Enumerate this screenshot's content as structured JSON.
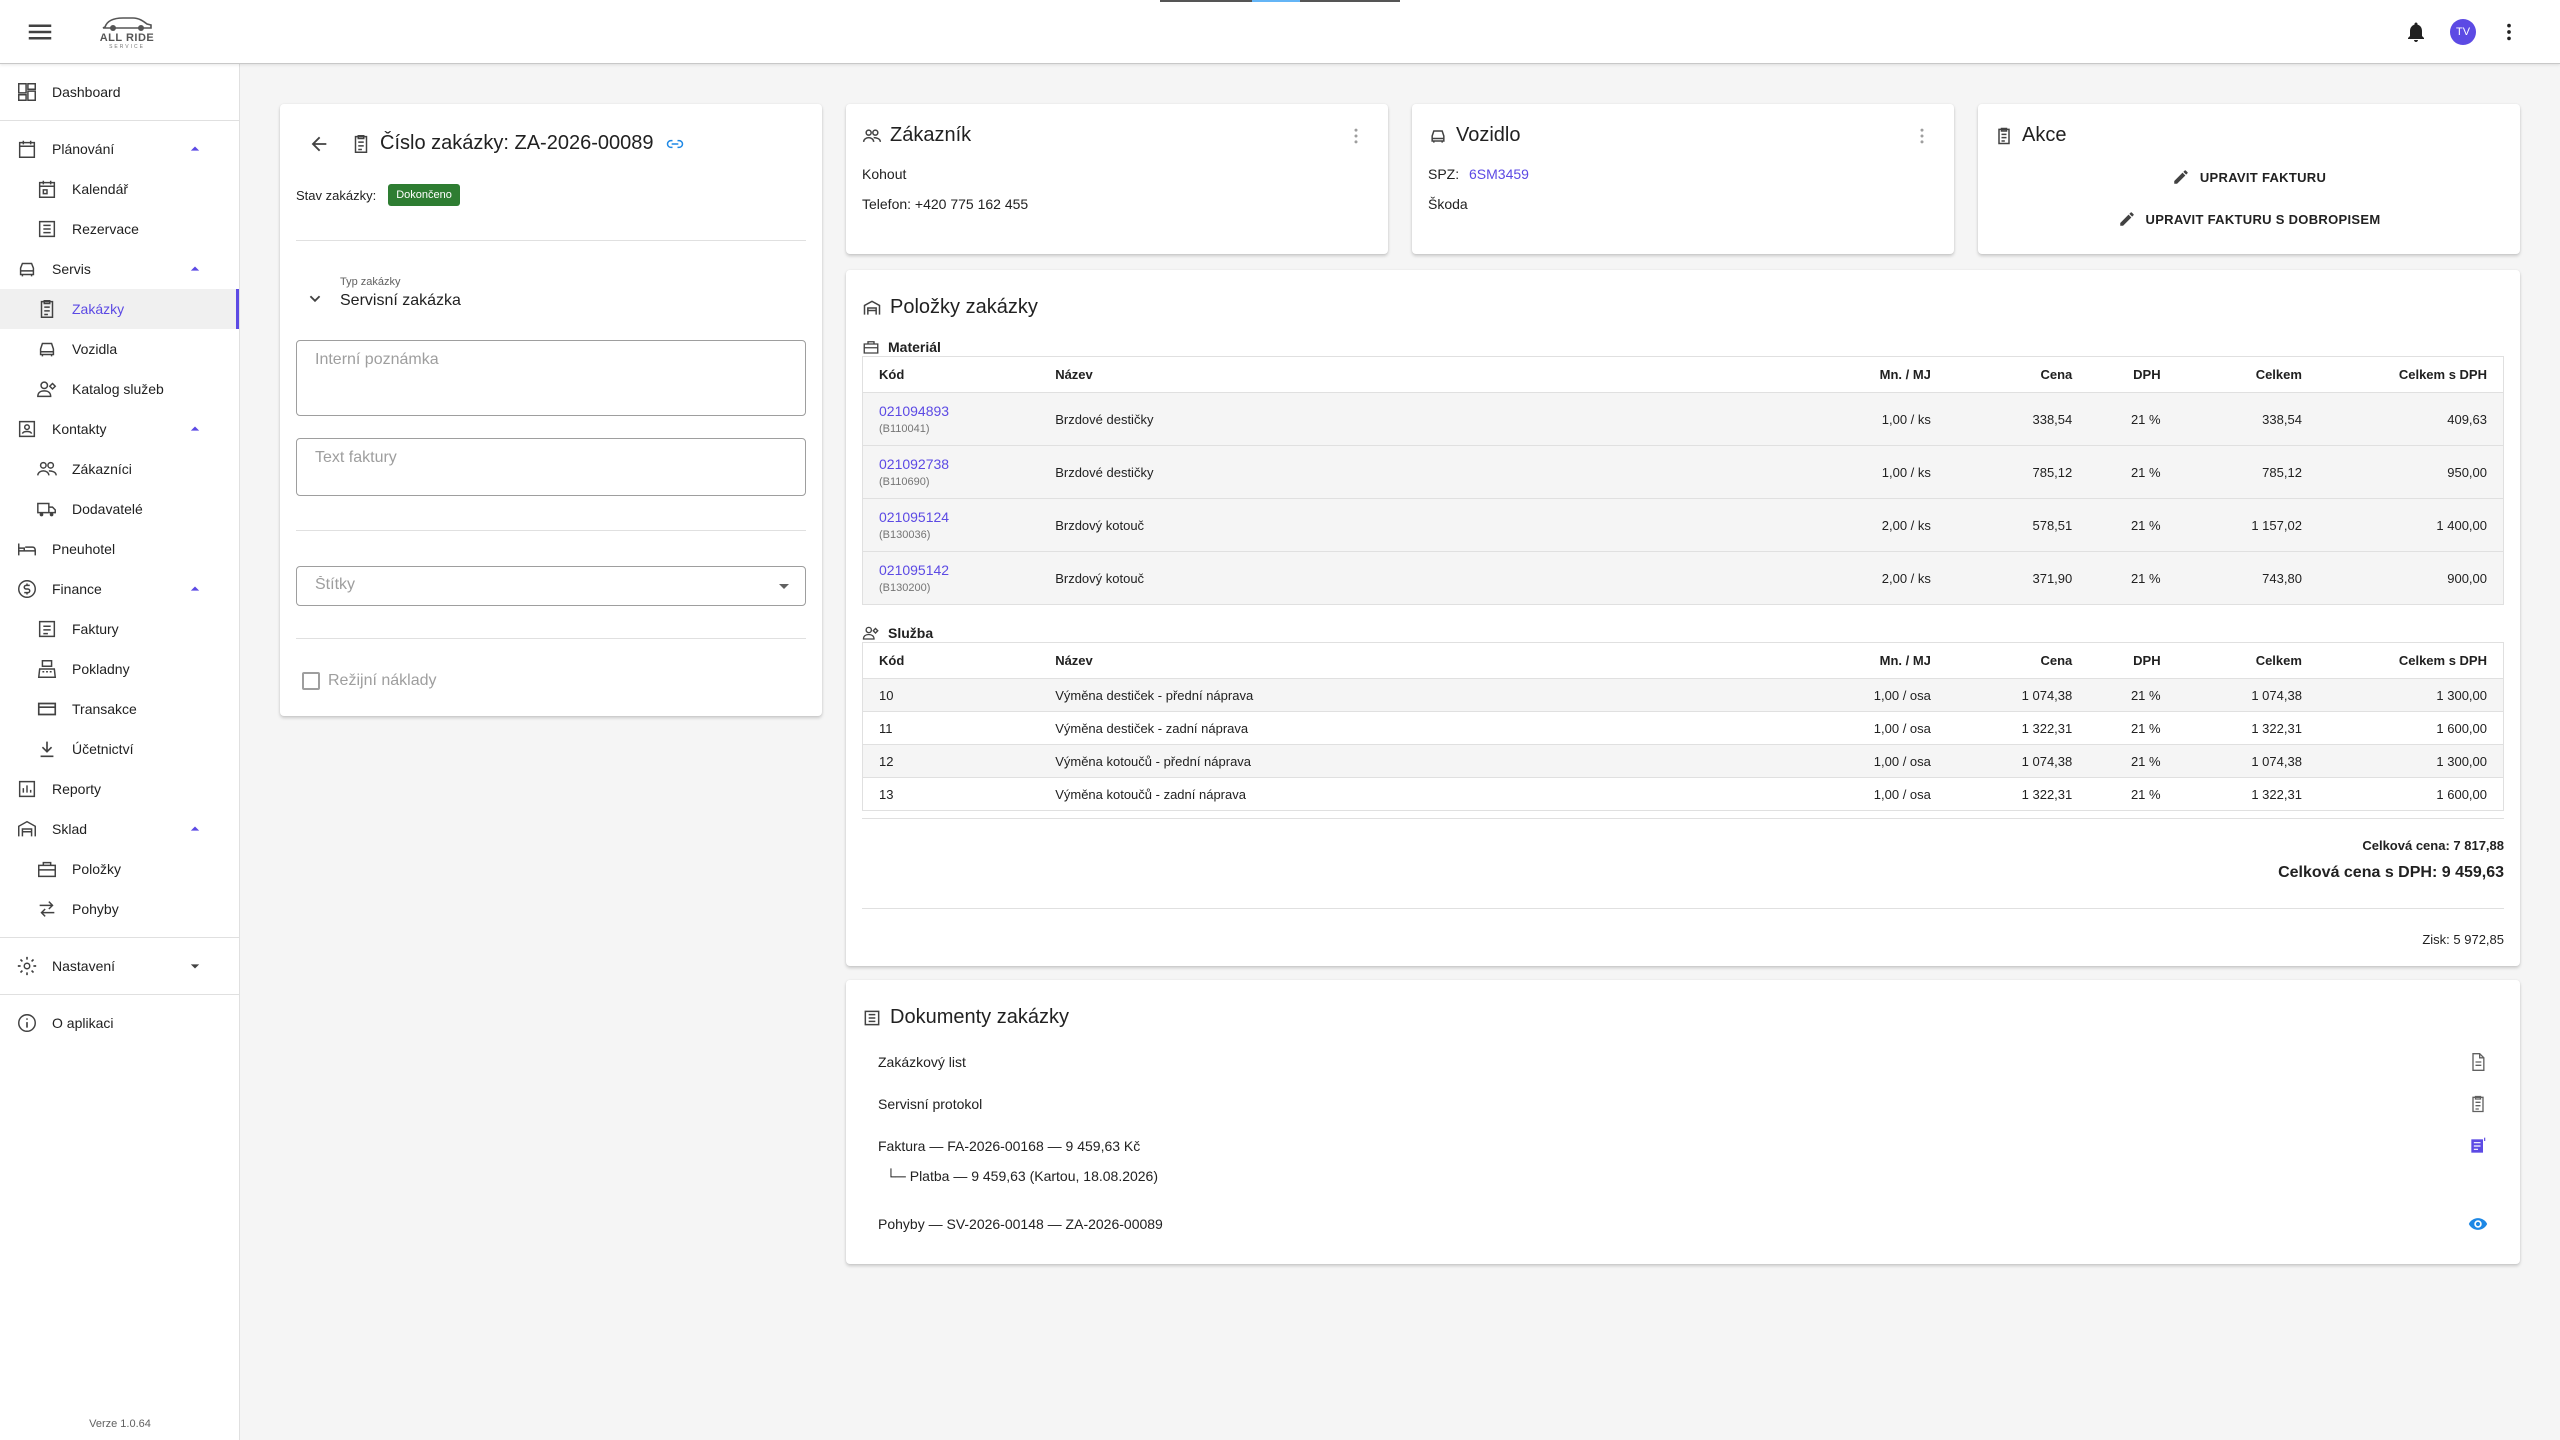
{
  "app": {
    "logo_text": "ALL RIDE",
    "logo_sub": "SERVICE",
    "avatar_initials": "TV",
    "version": "Verze 1.0.64"
  },
  "colors": {
    "accent": "#5c4ae4",
    "status_green": "#2e7d32",
    "link_blue": "#1e88e5"
  },
  "sidebar": {
    "dashboard": "Dashboard",
    "planovani": "Plánování",
    "kalendar": "Kalendář",
    "rezervace": "Rezervace",
    "servis": "Servis",
    "zakazky": "Zakázky",
    "vozidla": "Vozidla",
    "katalog": "Katalog služeb",
    "kontakty": "Kontakty",
    "zakaznici": "Zákazníci",
    "dodavatele": "Dodavatelé",
    "pneuhotel": "Pneuhotel",
    "finance": "Finance",
    "faktury": "Faktury",
    "pokladny": "Pokladny",
    "transakce": "Transakce",
    "ucetnictvi": "Účetnictví",
    "reporty": "Reporty",
    "sklad": "Sklad",
    "polozky": "Položky",
    "pohyby": "Pohyby",
    "nastaveni": "Nastavení",
    "o_aplikaci": "O aplikaci"
  },
  "order": {
    "title": "Číslo zakázky: ZA-2026-00089",
    "status_label": "Stav zakázky:",
    "status_value": "Dokončeno",
    "type_label": "Typ zakázky",
    "type_value": "Servisní zakázka",
    "internal_note_placeholder": "Interní poznámka",
    "invoice_text_placeholder": "Text faktury",
    "tags_placeholder": "Štítky",
    "overhead_label": "Režijní náklady"
  },
  "customer": {
    "title": "Zákazník",
    "name": "Kohout",
    "phone": "Telefon: +420 775 162 455"
  },
  "vehicle": {
    "title": "Vozidlo",
    "spz_label": "SPZ:",
    "spz_value": "6SM3459",
    "make": "Škoda"
  },
  "actions": {
    "title": "Akce",
    "edit_invoice": "UPRAVIT FAKTURU",
    "edit_invoice_credit": "UPRAVIT FAKTURU S DOBROPISEM"
  },
  "items": {
    "title": "Položky zakázky",
    "material_label": "Materiál",
    "service_label": "Služba",
    "columns": {
      "code": "Kód",
      "name": "Název",
      "qty": "Mn. / MJ",
      "price": "Cena",
      "vat": "DPH",
      "total": "Celkem",
      "total_vat": "Celkem s DPH"
    },
    "material": [
      {
        "code": "021094893",
        "sub": "(B110041)",
        "name": "Brzdové destičky",
        "qty": "1,00 / ks",
        "price": "338,54",
        "vat": "21 %",
        "total": "338,54",
        "total_vat": "409,63"
      },
      {
        "code": "021092738",
        "sub": "(B110690)",
        "name": "Brzdové destičky",
        "qty": "1,00 / ks",
        "price": "785,12",
        "vat": "21 %",
        "total": "785,12",
        "total_vat": "950,00"
      },
      {
        "code": "021095124",
        "sub": "(B130036)",
        "name": "Brzdový kotouč",
        "qty": "2,00 / ks",
        "price": "578,51",
        "vat": "21 %",
        "total": "1 157,02",
        "total_vat": "1 400,00"
      },
      {
        "code": "021095142",
        "sub": "(B130200)",
        "name": "Brzdový kotouč",
        "qty": "2,00 / ks",
        "price": "371,90",
        "vat": "21 %",
        "total": "743,80",
        "total_vat": "900,00"
      }
    ],
    "services": [
      {
        "code": "10",
        "name": "Výměna destiček - přední náprava",
        "qty": "1,00 / osa",
        "price": "1 074,38",
        "vat": "21 %",
        "total": "1 074,38",
        "total_vat": "1 300,00"
      },
      {
        "code": "11",
        "name": "Výměna destiček - zadní náprava",
        "qty": "1,00 / osa",
        "price": "1 322,31",
        "vat": "21 %",
        "total": "1 322,31",
        "total_vat": "1 600,00"
      },
      {
        "code": "12",
        "name": "Výměna kotoučů - přední náprava",
        "qty": "1,00 / osa",
        "price": "1 074,38",
        "vat": "21 %",
        "total": "1 074,38",
        "total_vat": "1 300,00"
      },
      {
        "code": "13",
        "name": "Výměna kotoučů - zadní náprava",
        "qty": "1,00 / osa",
        "price": "1 322,31",
        "vat": "21 %",
        "total": "1 322,31",
        "total_vat": "1 600,00"
      }
    ],
    "total_price": "Celková cena: 7 817,88",
    "total_price_vat": "Celková cena s DPH: 9 459,63",
    "profit": "Zisk: 5 972,85"
  },
  "documents": {
    "title": "Dokumenty zakázky",
    "order_sheet": "Zakázkový list",
    "service_protocol": "Servisní protokol",
    "invoice": "Faktura — FA-2026-00168 — 9 459,63 Kč",
    "payment": "└─ Platba — 9 459,63 (Kartou, 18.08.2026)",
    "movements": "Pohyby — SV-2026-00148 — ZA-2026-00089"
  }
}
